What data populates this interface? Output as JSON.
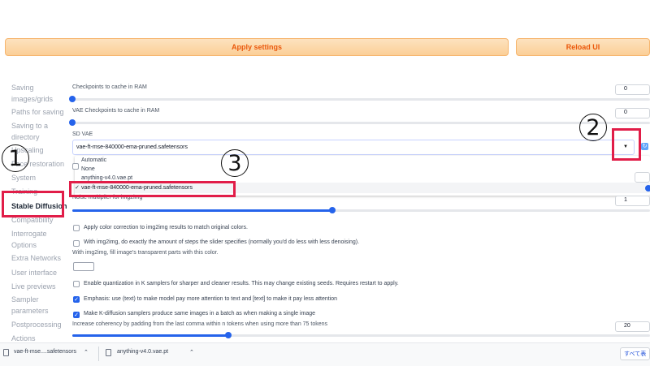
{
  "top_buttons": {
    "apply": "Apply settings",
    "reload": "Reload UI"
  },
  "sidebar": {
    "items": [
      "Saving images/grids",
      "Paths for saving",
      "Saving to a directory",
      "Upscaling",
      "Face restoration",
      "System",
      "Training",
      "Stable Diffusion",
      "Compatibility",
      "Interrogate Options",
      "Extra Networks",
      "User interface",
      "Live previews",
      "Sampler parameters",
      "Postprocessing",
      "Actions"
    ]
  },
  "settings": {
    "checkpoints_cache_label": "Checkpoints to cache in RAM",
    "checkpoints_cache_value": "0",
    "vae_checkpoints_cache_label": "VAE Checkpoints to cache in RAM",
    "vae_checkpoints_cache_value": "0",
    "sd_vae_label": "SD VAE",
    "sd_vae_value": "vae-ft-mse-840000-ema-pruned.safetensors",
    "sd_vae_options": [
      "Automatic",
      "None",
      "anything-v4.0.vae.pt",
      "vae-ft-mse-840000-ema-pruned.safetensors"
    ],
    "sd_vae_check": "✓",
    "noise_multiplier_label": "Noise multiplier for img2img",
    "noise_multiplier_value": "1",
    "noise_multiplier_level": 0.45,
    "color_correction_label": "Apply color correction to img2img results to match original colors.",
    "exact_steps_label": "With img2img, do exactly the amount of steps the slider specifies (normally you'd do less with less denoising).",
    "transparent_fill_label": "With img2img, fill image's transparent parts with this color.",
    "quantization_label": "Enable quantization in K samplers for sharper and cleaner results. This may change existing seeds. Requires restart to apply.",
    "emphasis_label": "Emphasis: use (text) to make model pay more attention to text and [text] to make it pay less attention",
    "batch_cond_uncond_label": "Make K-diffusion samplers produce same images in a batch as when making a single image",
    "comma_padding_label": "Increase coherency by padding from the last comma within n tokens when using more than 75 tokens",
    "comma_padding_value": "20",
    "comma_padding_level": 0.27
  },
  "annotations": {
    "one": "1",
    "two": "2",
    "three": "3"
  },
  "downloads": {
    "items": [
      "vae-ft-mse....safetensors",
      "anything-v4.0.vae.pt"
    ],
    "show_all": "すべて表"
  },
  "colors": {
    "accent": "#2563eb",
    "annotation_red": "#e11d48",
    "button_orange": "#fbcf97"
  }
}
